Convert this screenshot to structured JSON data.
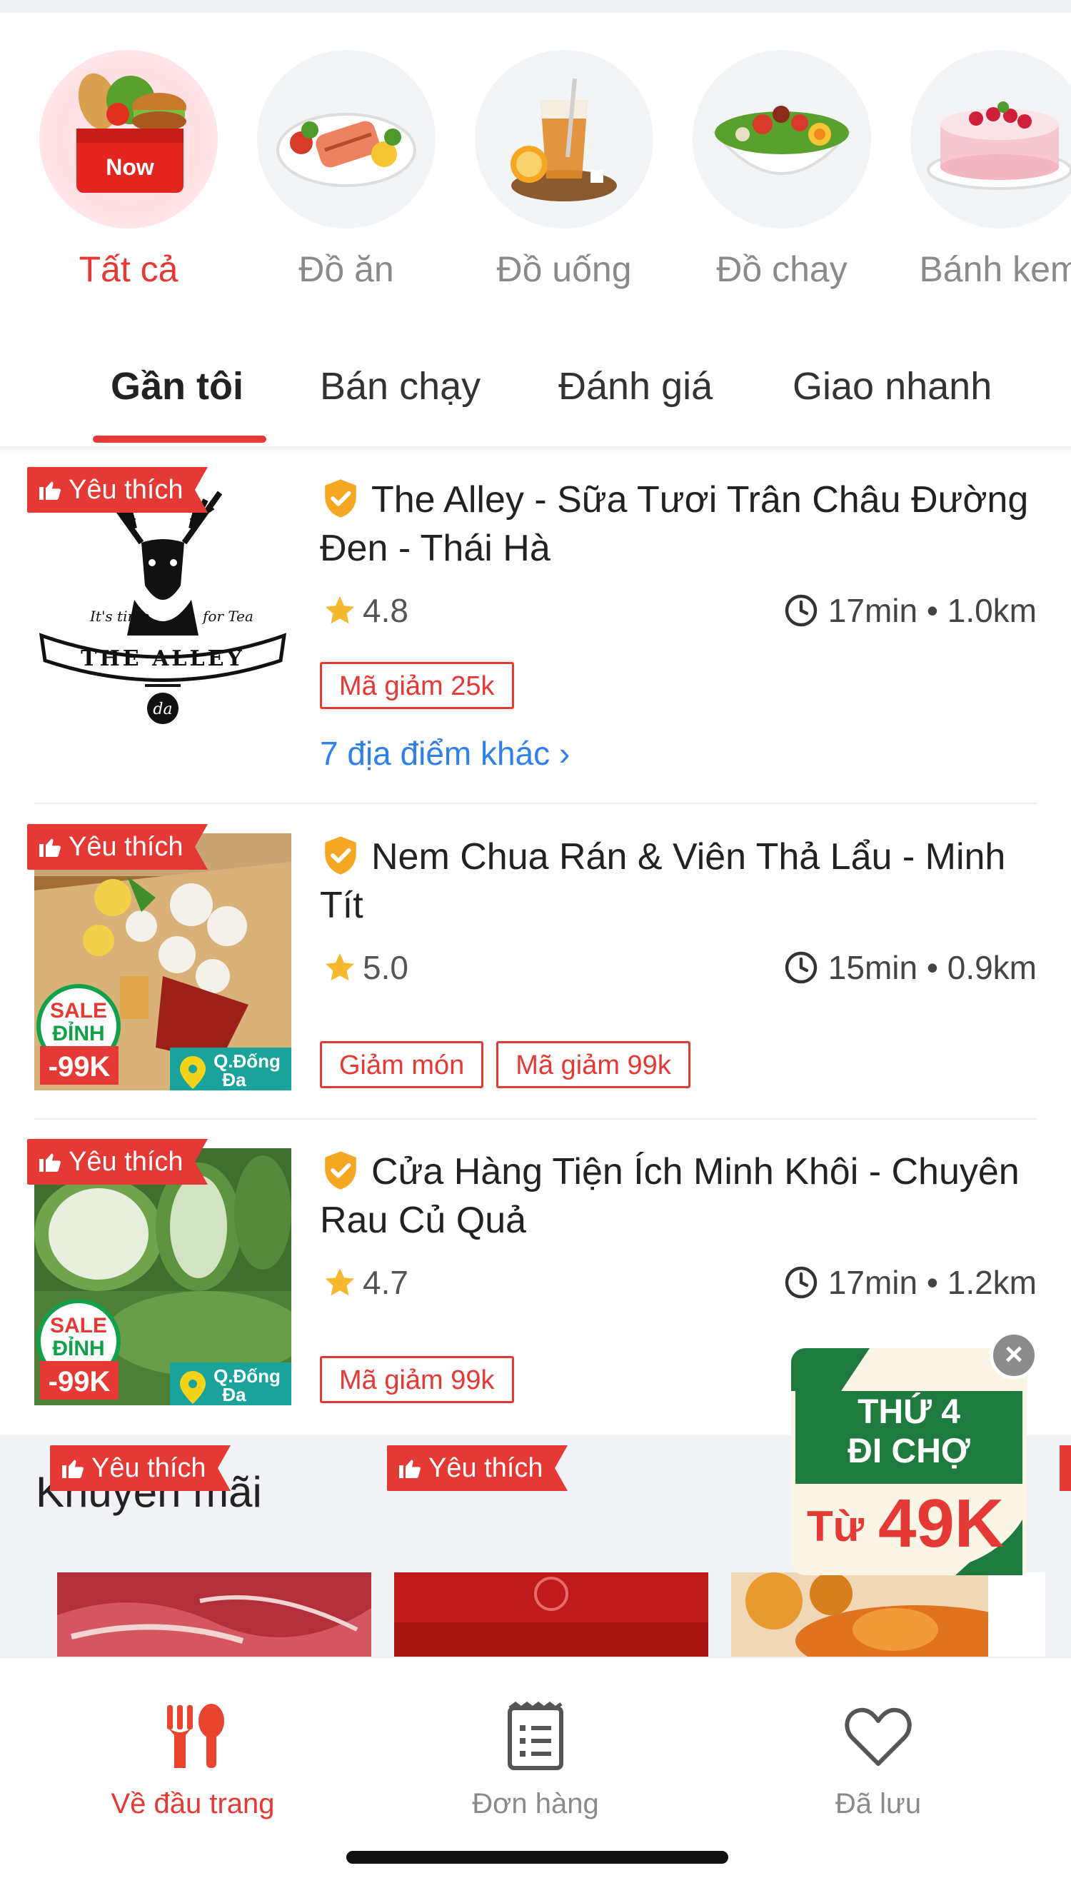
{
  "categories": [
    {
      "label": "Tất cả",
      "icon": "grocery-basket-icon",
      "badge": "Now",
      "active": true
    },
    {
      "label": "Đồ ăn",
      "icon": "grilled-salmon-plate-icon"
    },
    {
      "label": "Đồ uống",
      "icon": "iced-tea-icon"
    },
    {
      "label": "Đồ chay",
      "icon": "salad-bowl-icon"
    },
    {
      "label": "Bánh kem",
      "icon": "cake-icon"
    }
  ],
  "tabs": [
    {
      "label": "Gần tôi",
      "active": true
    },
    {
      "label": "Bán chạy"
    },
    {
      "label": "Đánh giá"
    },
    {
      "label": "Giao nhanh"
    }
  ],
  "restaurants": [
    {
      "favorite_label": "Yêu thích",
      "name": "The Alley - Sữa Tươi Trân Châu Đường Đen - Thái Hà",
      "rating": "4.8",
      "eta": "17min • 1.0km",
      "promos": [
        "Mã giảm 25k"
      ],
      "more_locations": "7 địa điểm khác ›",
      "logo_text": {
        "brand": "THE ALLEY",
        "tag_left": "It's time",
        "tag_right": "for Tea",
        "mark": "da"
      }
    },
    {
      "favorite_label": "Yêu thích",
      "name": "Nem Chua Rán & Viên Thả Lẩu - Minh Tít",
      "rating": "5.0",
      "eta": "15min • 0.9km",
      "promos": [
        "Giảm món",
        "Mã giảm 99k"
      ],
      "sale_badge": {
        "line1": "SALE",
        "line2": "ĐỈNH",
        "price": "-99K"
      },
      "location_tag": {
        "line1": "Q.Đống",
        "line2": "Đa"
      }
    },
    {
      "favorite_label": "Yêu thích",
      "name": "Cửa Hàng Tiện Ích Minh Khôi - Chuyên Rau Củ Quả",
      "rating": "4.7",
      "eta": "17min • 1.2km",
      "promos": [
        "Mã giảm 99k"
      ],
      "sale_badge": {
        "line1": "SALE",
        "line2": "ĐỈNH",
        "price": "-99K"
      },
      "location_tag": {
        "line1": "Q.Đống",
        "line2": "Đa"
      }
    }
  ],
  "promo_section": {
    "title": "Khuyến mãi",
    "cards": [
      {
        "favorite_label": "Yêu thích"
      },
      {
        "favorite_label": "Yêu thích"
      },
      {}
    ]
  },
  "floating_ad": {
    "line1": "THỨ 4",
    "line2": "ĐI CHỢ",
    "price_prefix": "Từ",
    "price": "49K",
    "close_icon": "×"
  },
  "bottom_nav": [
    {
      "label": "Về đầu trang",
      "icon": "fork-spoon-icon",
      "active": true
    },
    {
      "label": "Đơn hàng",
      "icon": "clipboard-list-icon"
    },
    {
      "label": "Đã lưu",
      "icon": "heart-icon"
    }
  ],
  "colors": {
    "accent": "#e53935",
    "link": "#2f80ed",
    "star": "#f5b82e",
    "verified": "#f5a623",
    "muted": "#8a8a8a"
  }
}
